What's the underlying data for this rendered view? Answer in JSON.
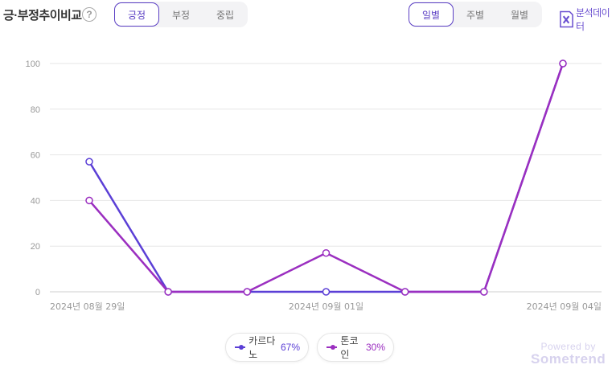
{
  "header": {
    "title": "긍·부정추이비교",
    "help_glyph": "?",
    "sentiment_tabs": [
      {
        "label": "긍정",
        "active": true
      },
      {
        "label": "부정",
        "active": false
      },
      {
        "label": "중립",
        "active": false
      }
    ],
    "period_tabs": [
      {
        "label": "일별",
        "active": true
      },
      {
        "label": "주별",
        "active": false
      },
      {
        "label": "월별",
        "active": false
      }
    ],
    "excel_label": "분석데이터"
  },
  "legend": [
    {
      "name": "카르다노",
      "pct": "67%",
      "color": "#5b3fd6"
    },
    {
      "name": "톤코인",
      "pct": "30%",
      "color": "#9b2fc0"
    }
  ],
  "powered": {
    "line1": "Powered by",
    "line2": "Sometrend"
  },
  "chart_data": {
    "type": "line",
    "title": "",
    "xlabel": "",
    "ylabel": "",
    "x": [
      "2024-08-29",
      "2024-08-30",
      "2024-08-31",
      "2024-09-01",
      "2024-09-02",
      "2024-09-03",
      "2024-09-04"
    ],
    "x_tick_labels": [
      {
        "index": 0,
        "label": "2024년 08월 29일"
      },
      {
        "index": 3,
        "label": "2024년 09월 01일"
      },
      {
        "index": 6,
        "label": "2024년 09월 04일"
      }
    ],
    "ylim": [
      0,
      100
    ],
    "yticks": [
      0,
      20,
      40,
      60,
      80,
      100
    ],
    "grid": true,
    "legend_position": "bottom",
    "series": [
      {
        "name": "카르다노",
        "color": "#5b3fd6",
        "values": [
          57,
          0,
          0,
          0,
          0,
          0,
          100
        ]
      },
      {
        "name": "톤코인",
        "color": "#9b2fc0",
        "values": [
          40,
          0,
          0,
          17,
          0,
          0,
          100
        ]
      }
    ]
  }
}
